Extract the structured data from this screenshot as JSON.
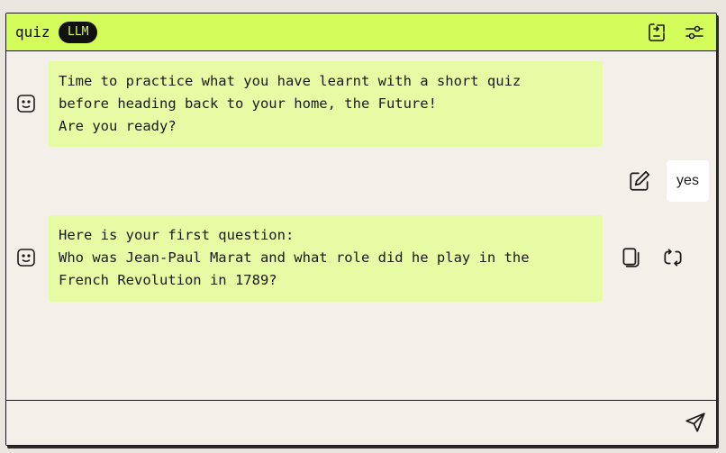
{
  "header": {
    "title": "quiz",
    "badge": "LLM",
    "background_color": "#d4fd5b",
    "icons": [
      "export-icon",
      "settings-sliders-icon"
    ]
  },
  "messages": [
    {
      "role": "assistant",
      "avatar_icon": "robot-face-icon",
      "text": "Time to practice what you have learnt with a short quiz\nbefore heading back to your home, the Future!\nAre you ready?"
    },
    {
      "role": "user",
      "text": "yes",
      "action_icon": "edit-icon"
    },
    {
      "role": "assistant",
      "avatar_icon": "robot-face-icon",
      "text": "Here is your first question:\nWho was Jean-Paul Marat and what role did he play in the\nFrench Revolution in 1789?",
      "action_icons": [
        "copy-icon",
        "regenerate-icon"
      ]
    }
  ],
  "composer": {
    "value": "",
    "placeholder": "",
    "send_icon": "send-icon"
  },
  "colors": {
    "assistant_bubble": "#e6fba4",
    "user_bubble": "#ffffff",
    "background": "#f2f0e8",
    "border": "#1a1a1a"
  }
}
